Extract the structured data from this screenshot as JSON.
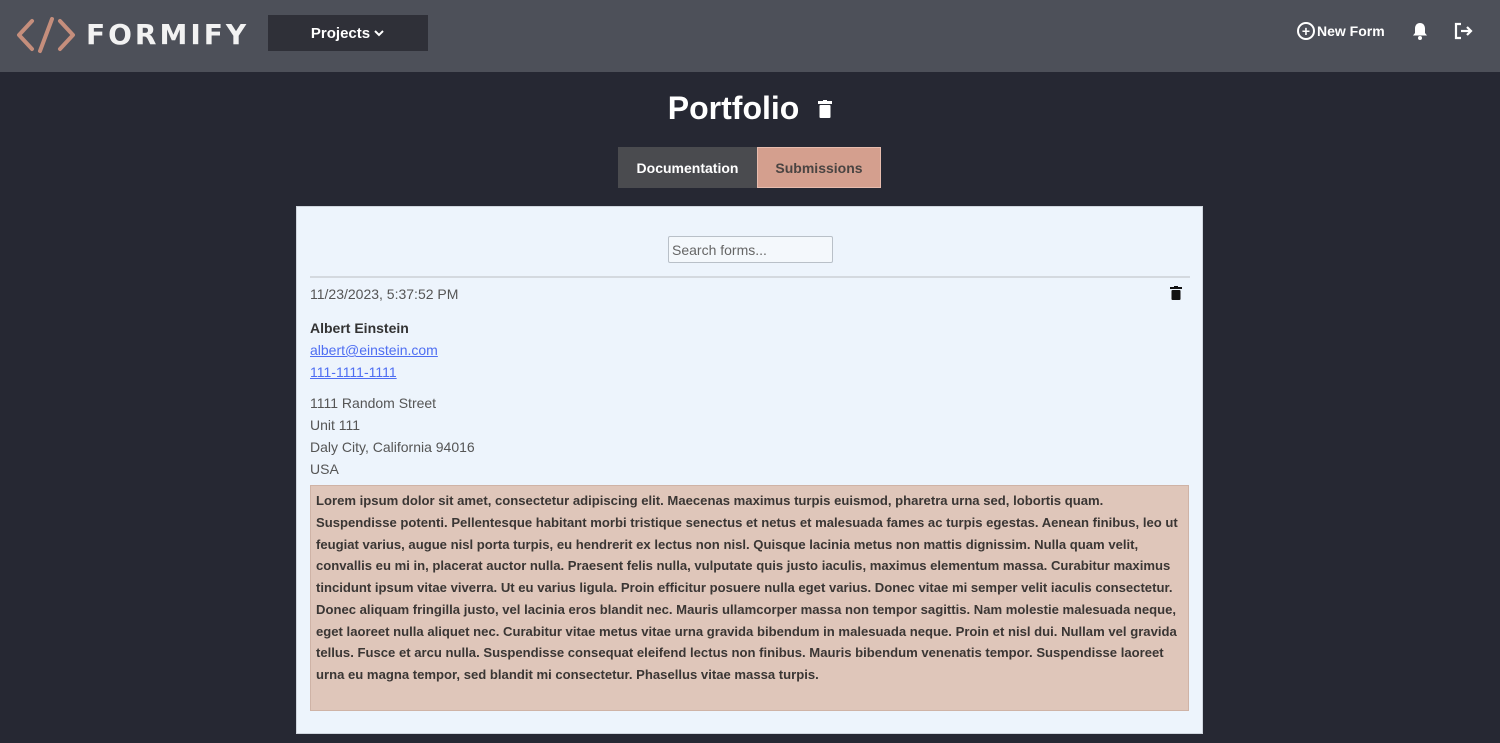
{
  "brand": {
    "name": "FORMIFY",
    "accent": "#c58e7c"
  },
  "nav": {
    "projects_label": "Projects",
    "new_form_label": "New Form",
    "icons": [
      "chevron-down-icon",
      "plus-circle-icon",
      "bell-icon",
      "logout-icon"
    ]
  },
  "page": {
    "title": "Portfolio"
  },
  "tabs": [
    {
      "label": "Documentation",
      "active": false
    },
    {
      "label": "Submissions",
      "active": true
    }
  ],
  "search": {
    "placeholder": "Search forms...",
    "value": ""
  },
  "submission": {
    "timestamp": "11/23/2023, 5:37:52 PM",
    "name": "Albert Einstein",
    "email": "albert@einstein.com",
    "phone": "111-1111-1111",
    "address": [
      "1111 Random Street",
      "Unit 111",
      "Daly City, California 94016",
      "USA"
    ],
    "message": "Lorem ipsum dolor sit amet, consectetur adipiscing elit. Maecenas maximus turpis euismod, pharetra urna sed, lobortis quam. Suspendisse potenti. Pellentesque habitant morbi tristique senectus et netus et malesuada fames ac turpis egestas. Aenean finibus, leo ut feugiat varius, augue nisl porta turpis, eu hendrerit ex lectus non nisl. Quisque lacinia metus non mattis dignissim. Nulla quam velit, convallis eu mi in, placerat auctor nulla. Praesent felis nulla, vulputate quis justo iaculis, maximus elementum massa. Curabitur maximus tincidunt ipsum vitae viverra. Ut eu varius ligula. Proin efficitur posuere nulla eget varius. Donec vitae mi semper velit iaculis consectetur. Donec aliquam fringilla justo, vel lacinia eros blandit nec. Mauris ullamcorper massa non tempor sagittis. Nam molestie malesuada neque, eget laoreet nulla aliquet nec. Curabitur vitae metus vitae urna gravida bibendum in malesuada neque. Proin et nisl dui. Nullam vel gravida tellus. Fusce et arcu nulla. Suspendisse consequat eleifend lectus non finibus. Mauris bibendum venenatis tempor. Suspendisse laoreet urna eu magna tempor, sed blandit mi consectetur. Phasellus vitae massa turpis."
  }
}
